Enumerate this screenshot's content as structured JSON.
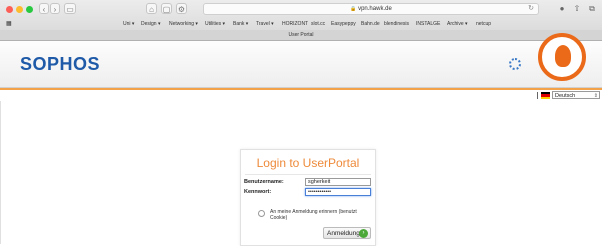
{
  "browser": {
    "url": "vpn.hawk.de",
    "tab_title": "User Portal",
    "bookmarks": [
      "Uni ▾",
      "Design ▾",
      "Networking ▾",
      "Utilities ▾",
      "Bank ▾",
      "Travel ▾",
      "HORIZONT",
      "slot.cc",
      "Easypeppy",
      "Bahn.de",
      "blendinesis",
      "INSTALGE",
      "Archive ▾",
      "netcup"
    ],
    "icons": [
      "back-icon",
      "forward-icon",
      "sidebar-icon",
      "home-icon",
      "share-icon",
      "reload-icon",
      "download-icon",
      "add-tab-icon"
    ]
  },
  "header": {
    "brand": "SOPHOS",
    "accent_color": "#ea6a1a",
    "stripe_color": "#f3a24a"
  },
  "language": {
    "selected": "Deutsch",
    "flag_colors": [
      "#000000",
      "#dd0000",
      "#ffce00"
    ]
  },
  "login": {
    "title": "Login to UserPortal",
    "username_label": "Benutzername:",
    "username_value": "sgherkeit",
    "password_label": "Kennwort:",
    "password_value": "••••••••••••",
    "remember_label": "An meine Anmeldung erinnern (benutzt Cookie)",
    "submit_label": "Anmeldung",
    "title_color": "#ee8a3a"
  }
}
